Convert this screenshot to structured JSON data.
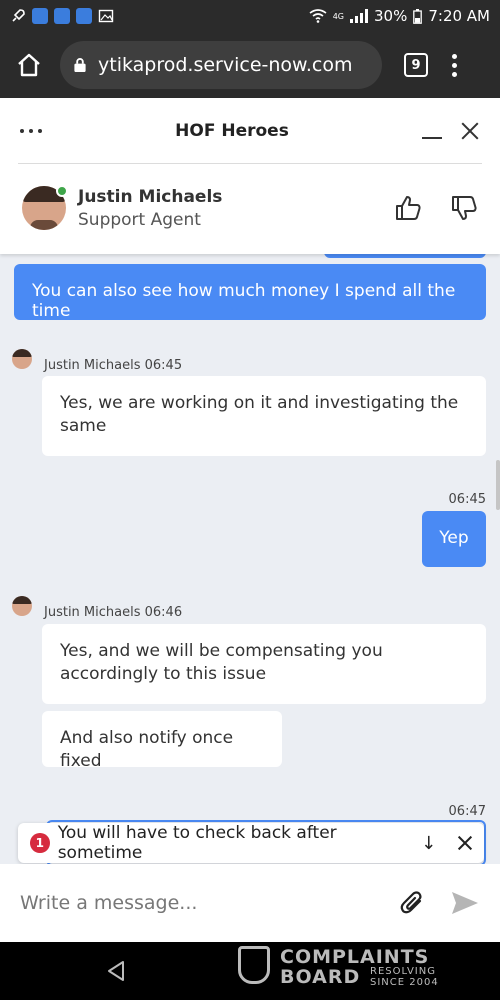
{
  "status_bar": {
    "battery": "30%",
    "time": "7:20 AM",
    "network_label": "4G"
  },
  "browser": {
    "url": "ytikaprod.service-now.com",
    "tab_count": "9"
  },
  "chat_header": {
    "title": "HOF Heroes",
    "agent_name": "Justin Michaels",
    "agent_role": "Support Agent"
  },
  "messages": {
    "m1_text": "You can also see how much money I spend all the time",
    "m2_meta": "Justin Michaels 06:45",
    "m2_text": "Yes, we are working on it and investigating the same",
    "m3_time": "06:45",
    "m3_text": "Yep",
    "m4_meta": "Justin Michaels 06:46",
    "m4_text": "Yes, and we will be compensating you accordingly to this issue",
    "m5_text": "And also notify once fixed",
    "m6_time": "06:47"
  },
  "notification": {
    "count": "1",
    "text": "You will have to check back after sometime"
  },
  "composer": {
    "placeholder": "Write a message..."
  },
  "watermark": {
    "line1": "COMPLAINTS",
    "line2": "BOARD",
    "tag1": "RESOLVING",
    "tag2": "SINCE 2004"
  },
  "colors": {
    "accent_blue": "#4a8af4",
    "online_green": "#3fa64a",
    "badge_red": "#d62b3e"
  }
}
